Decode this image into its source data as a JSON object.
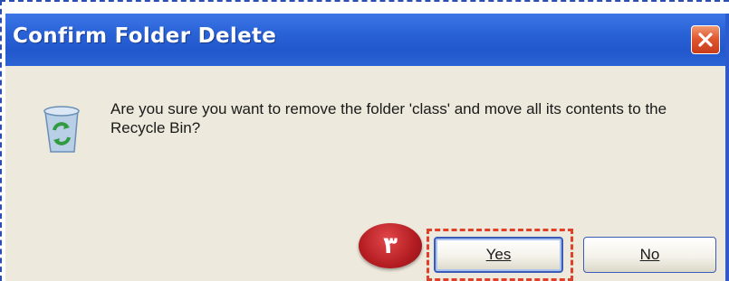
{
  "dialog": {
    "title": "Confirm Folder Delete",
    "message": "Are you sure you want to remove the folder 'class' and move all its contents to the Recycle Bin?",
    "icon": "recycle-bin-icon",
    "close_icon": "close-icon"
  },
  "buttons": {
    "yes_label": "Yes",
    "no_label": "No"
  },
  "annotation": {
    "step_number": "۳",
    "highlight_color": "#e0402a",
    "badge_color": "#b31d22"
  },
  "colors": {
    "titlebar": "#2a63d8",
    "dialog_bg": "#ede9dc"
  }
}
